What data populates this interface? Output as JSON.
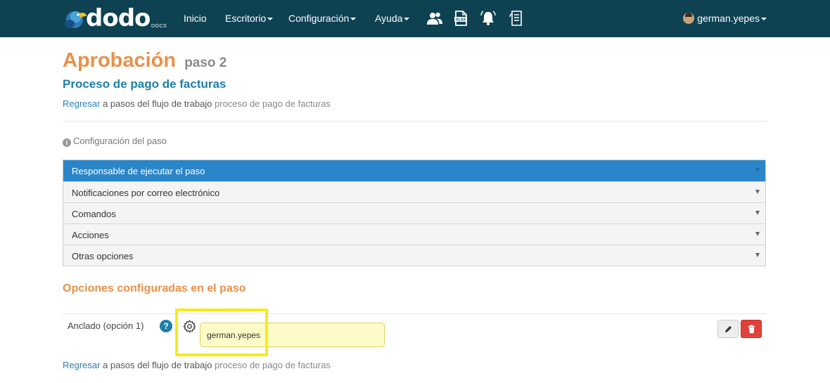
{
  "brand": {
    "name": "dodo",
    "sub": "DOCS",
    "registered": "®"
  },
  "nav": {
    "items": [
      {
        "label": "Inicio",
        "dropdown": false
      },
      {
        "label": "Escritorio",
        "dropdown": true
      },
      {
        "label": "Configuración",
        "dropdown": true
      },
      {
        "label": "Ayuda",
        "dropdown": true
      }
    ],
    "icons": [
      "users-icon",
      "xlsx-file-icon",
      "notification-bell-icon",
      "document-list-icon"
    ],
    "user": "german.yepes"
  },
  "header": {
    "title": "Aprobación",
    "step": "paso 2",
    "process": "Proceso de pago de facturas",
    "back_link": "Regresar",
    "back_text": " a pasos del flujo de trabajo ",
    "back_process": "proceso de pago de facturas"
  },
  "config": {
    "label": "Configuración del paso",
    "sections": [
      {
        "label": "Responsable de ejecutar el paso",
        "active": true
      },
      {
        "label": "Notificaciones por correo electrónico",
        "active": false
      },
      {
        "label": "Comandos",
        "active": false
      },
      {
        "label": "Acciones",
        "active": false
      },
      {
        "label": "Otras opciones",
        "active": false
      }
    ]
  },
  "options": {
    "title": "Opciones configuradas en el paso",
    "row": {
      "label": "Anclado (opción 1)",
      "help": "?",
      "value": "german.yepes"
    }
  },
  "footer": {
    "back_link": "Regresar",
    "back_text": " a pasos del flujo de trabajo ",
    "back_process": "proceso de pago de facturas"
  },
  "colors": {
    "navbar": "#0e4252",
    "accent_orange": "#e8914a",
    "accent_blue": "#1f7ea5",
    "active_section": "#2b86c9",
    "value_fill": "#fdfbc8",
    "highlight": "#f5ec18",
    "delete": "#e0423a"
  }
}
